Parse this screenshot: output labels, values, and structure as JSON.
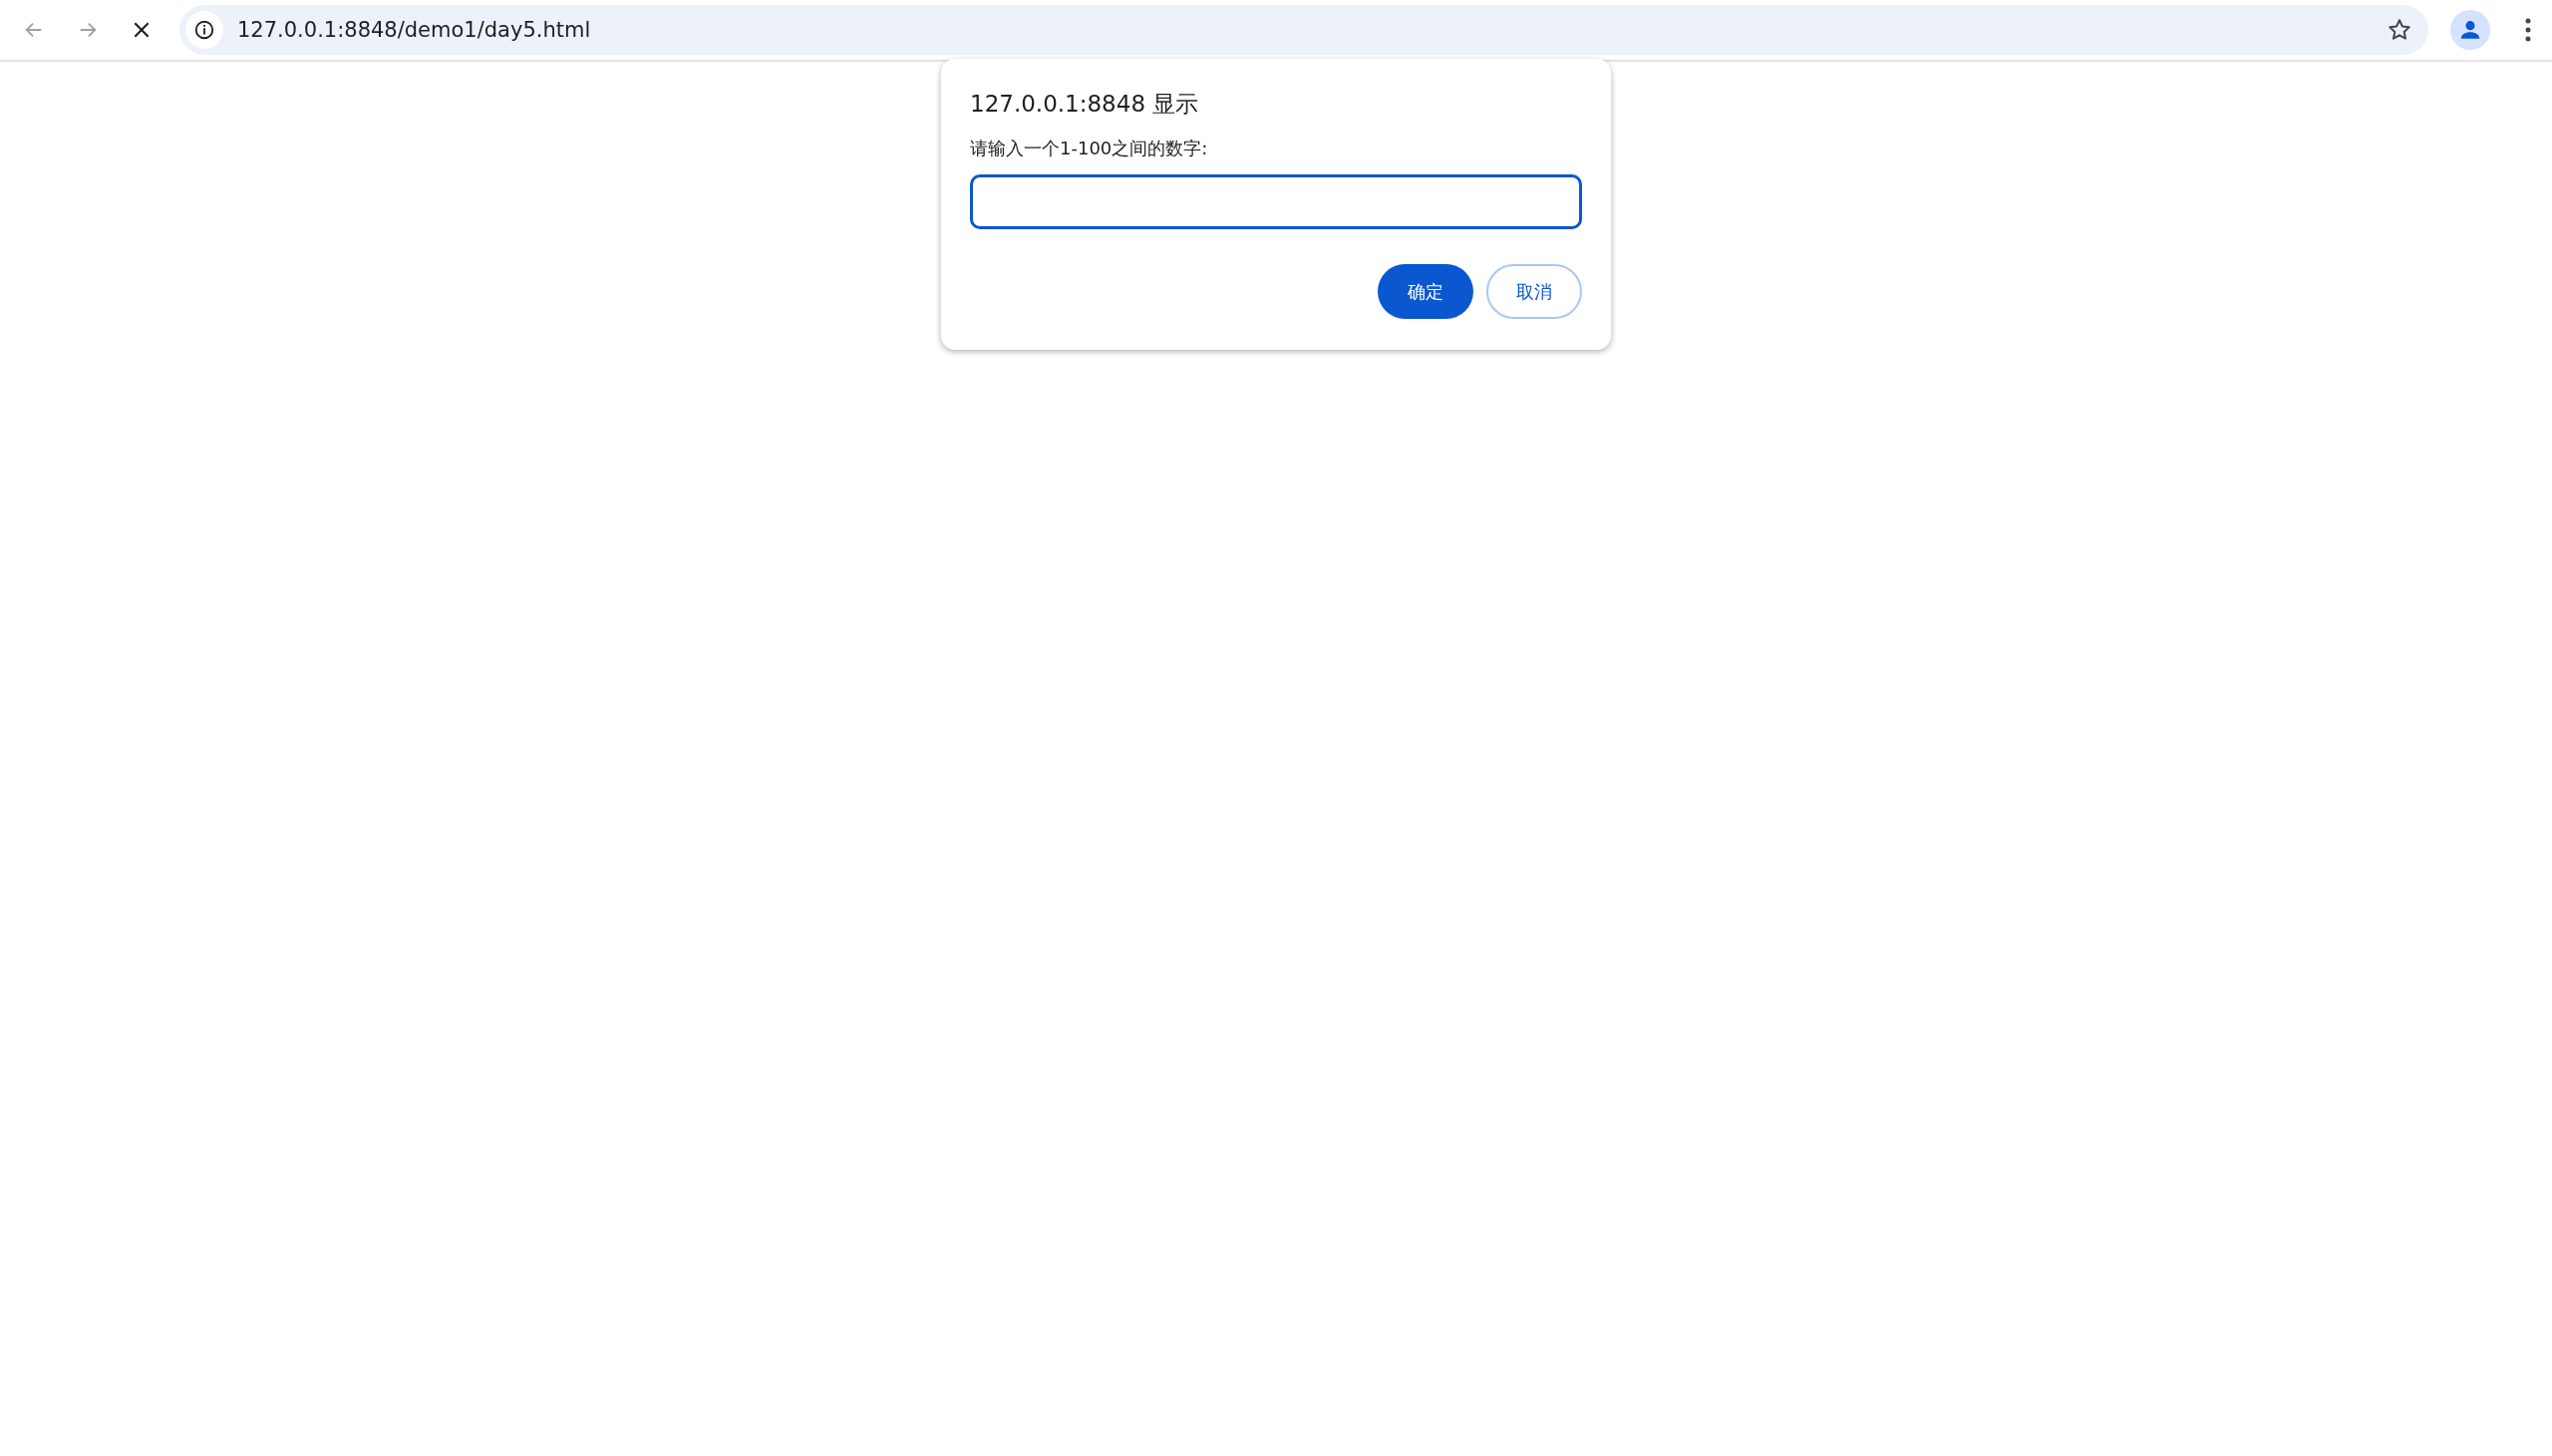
{
  "toolbar": {
    "nav_buttons": [
      {
        "kind": "back",
        "disabled": true
      },
      {
        "kind": "forward",
        "disabled": true
      },
      {
        "kind": "stop",
        "disabled": false
      }
    ],
    "url": "127.0.0.1:8848/demo1/day5.html"
  },
  "dialog": {
    "title": "127.0.0.1:8848 显示",
    "message": "请输入一个1-100之间的数字:",
    "input": {
      "focused": true
    },
    "buttons": [
      {
        "label": "确定",
        "kind": "primary"
      },
      {
        "label": "取消",
        "kind": "secondary"
      }
    ]
  }
}
